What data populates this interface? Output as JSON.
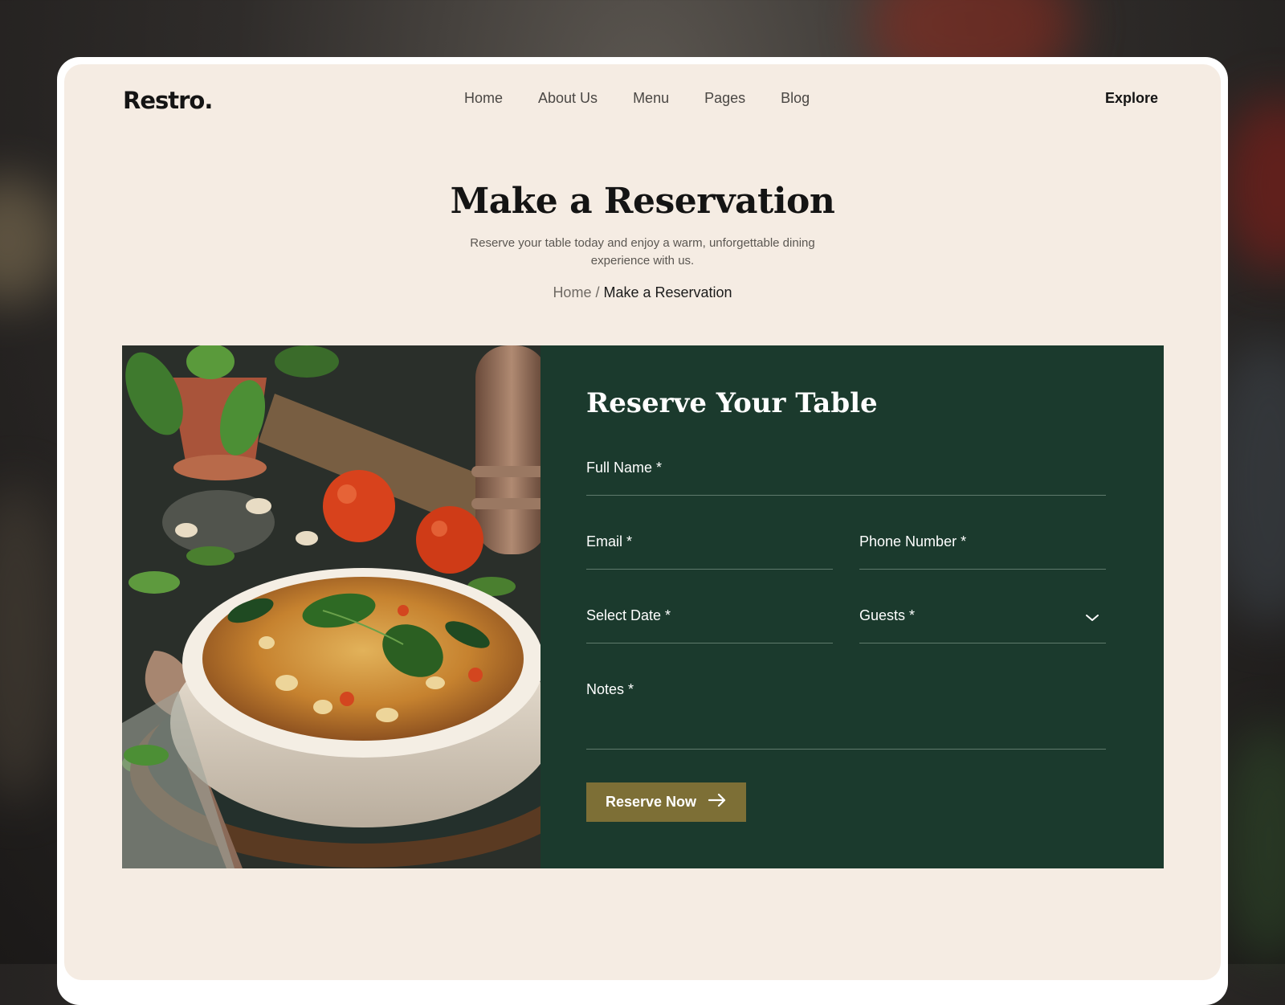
{
  "brand": {
    "logo": "Restro."
  },
  "nav": {
    "items": [
      "Home",
      "About Us",
      "Menu",
      "Pages",
      "Blog"
    ],
    "explore": "Explore"
  },
  "hero": {
    "title": "Make a Reservation",
    "subtitle": "Reserve your table today and enjoy a warm, unforgettable dining experience with us.",
    "breadcrumb": {
      "home": "Home",
      "separator": " / ",
      "current": "Make a Reservation"
    }
  },
  "form": {
    "title": "Reserve Your Table",
    "fields": {
      "full_name": "Full Name  *",
      "email": "Email  *",
      "phone": "Phone Number  *",
      "date": "Select Date *",
      "guests": "Guests  *",
      "notes": "Notes *"
    },
    "submit": "Reserve Now",
    "submit_icon": "arrow-right-icon",
    "guests_icon": "chevron-down-icon"
  },
  "colors": {
    "page_bg": "#f5ece3",
    "panel_bg": "#1b3a2d",
    "button_bg": "#7d6f36",
    "text_dark": "#141414"
  }
}
